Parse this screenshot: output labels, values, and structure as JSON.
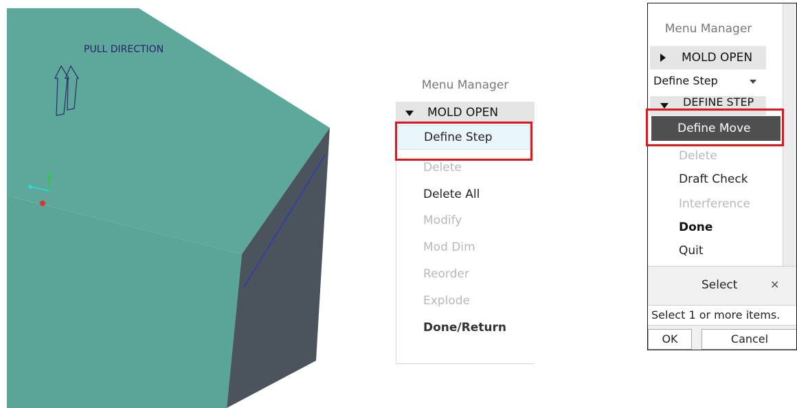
{
  "viewport": {
    "pull_direction_label": "PULL DIRECTION",
    "icons": [
      "pull-direction-arrow-icon",
      "coordinate-axes-icon"
    ],
    "colors": {
      "top_face": "#5ea89b",
      "front_face": "#5ba597",
      "side_face": "#4b545c",
      "edge": "#2a3ab8"
    }
  },
  "menu_manager_1": {
    "title": "Menu Manager",
    "header": "MOLD OPEN",
    "selected": "Define Step",
    "items": [
      {
        "label": "Delete",
        "enabled": false
      },
      {
        "label": "Delete All",
        "enabled": true
      },
      {
        "label": "Modify",
        "enabled": false
      },
      {
        "label": "Mod Dim",
        "enabled": false
      },
      {
        "label": "Reorder",
        "enabled": false
      },
      {
        "label": "Explode",
        "enabled": false
      },
      {
        "label": "Done/Return",
        "enabled": true,
        "bold": true
      }
    ]
  },
  "menu_manager_2": {
    "title": "Menu Manager",
    "header_collapsed": "MOLD OPEN",
    "define_step": "Define Step",
    "sub_header": "DEFINE STEP",
    "selected": "Define Move",
    "items": [
      {
        "label": "Delete",
        "enabled": false
      },
      {
        "label": "Draft Check",
        "enabled": true
      },
      {
        "label": "Interference",
        "enabled": false
      },
      {
        "label": "Done",
        "enabled": true,
        "bold": true
      },
      {
        "label": "Quit",
        "enabled": true
      }
    ],
    "select_dialog": {
      "title": "Select",
      "close_glyph": "✕",
      "hint": "Select 1 or more items.",
      "ok": "OK",
      "cancel": "Cancel"
    }
  },
  "highlight_color": "#e0161c"
}
